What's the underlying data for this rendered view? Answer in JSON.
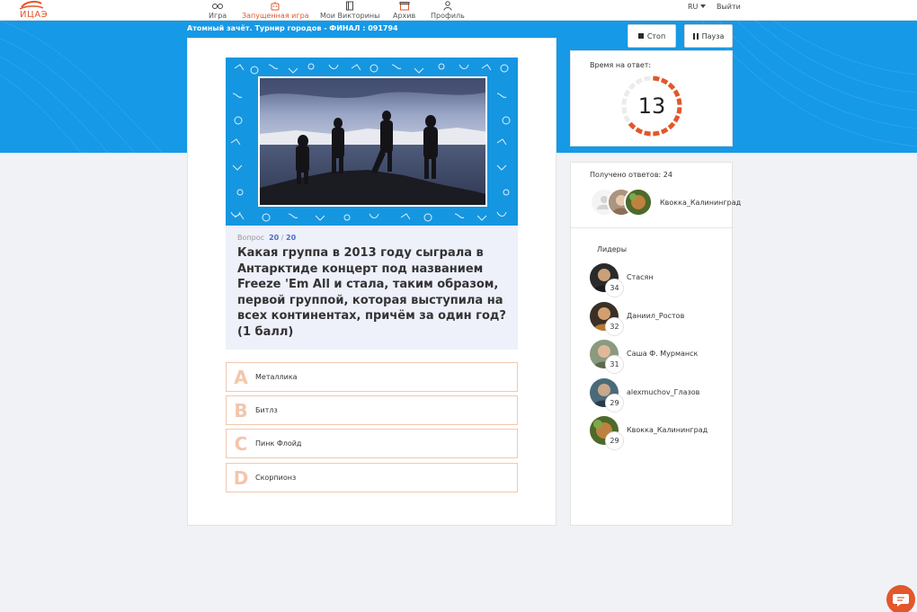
{
  "app": {
    "logo_text": "ИЦАЭ"
  },
  "nav": {
    "items": [
      {
        "label": "Игра",
        "icon": "glasses-icon"
      },
      {
        "label": "Запущенная игра",
        "icon": "robot-icon",
        "active": true
      },
      {
        "label": "Мои Викторины",
        "icon": "book-icon"
      },
      {
        "label": "Архив",
        "icon": "archive-icon"
      },
      {
        "label": "Профиль",
        "icon": "user-icon"
      }
    ],
    "lang": "RU",
    "logout": "Выйти"
  },
  "game": {
    "title": "Атомный зачёт. Турнир городов - ФИНАЛ : 091794",
    "stop_label": "Стоп",
    "pause_label": "Пауза"
  },
  "question": {
    "label": "Вопрос",
    "current": "20",
    "separator": "/",
    "total": "20",
    "text": "Какая группа в 2013 году сыграла в Антарктиде концерт под названием Freeze 'Em All и стала, таким образом, первой группой, которая выступила на всех континентах, причём за один год?",
    "points": "(1 балл)"
  },
  "answers": [
    {
      "letter": "A",
      "text": "Металлика"
    },
    {
      "letter": "B",
      "text": "Битлз"
    },
    {
      "letter": "C",
      "text": "Пинк Флойд"
    },
    {
      "letter": "D",
      "text": "Скорпионз"
    }
  ],
  "timer": {
    "label": "Время на ответ:",
    "seconds": "13",
    "remaining_fraction": 0.65
  },
  "responses": {
    "label": "Получено ответов: 24",
    "latest_name": "Квокка_Калининград"
  },
  "leaders": {
    "title": "Лидеры",
    "items": [
      {
        "name": "Стасян",
        "score": "34"
      },
      {
        "name": "Даниил_Ростов",
        "score": "32"
      },
      {
        "name": "Саша Ф. Мурманск",
        "score": "31"
      },
      {
        "name": "alexmuchov_Глазов",
        "score": "29"
      },
      {
        "name": "Квокка_Калининград",
        "score": "29"
      }
    ]
  },
  "colors": {
    "accent": "#e2572b",
    "band": "#1699e6",
    "answer_border": "#f2c7ad"
  }
}
